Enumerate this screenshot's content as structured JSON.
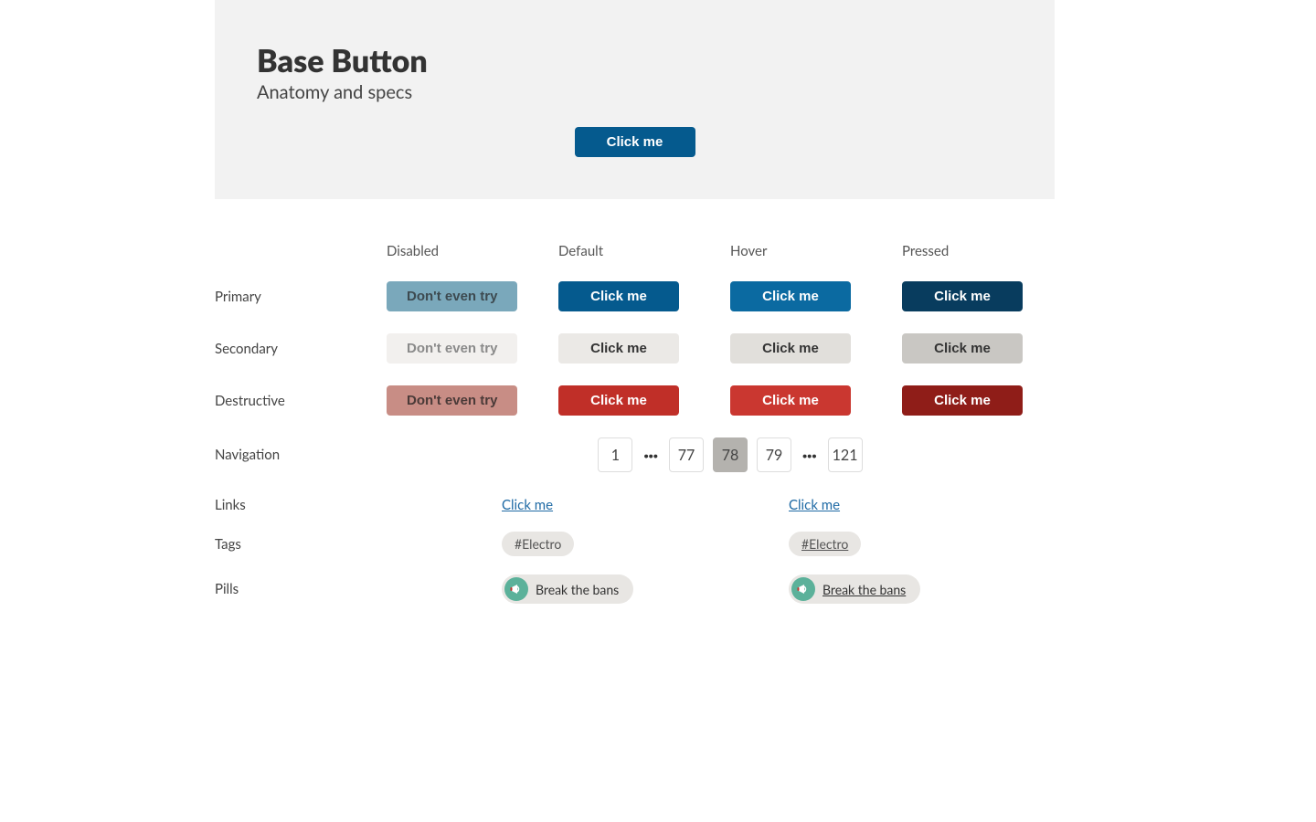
{
  "hero": {
    "title": "Base Button",
    "subtitle": "Anatomy and specs",
    "cta": "Click me"
  },
  "columns": {
    "disabled": "Disabled",
    "default": "Default",
    "hover": "Hover",
    "pressed": "Pressed"
  },
  "rows": {
    "primary": "Primary",
    "secondary": "Secondary",
    "destructive": "Destructive",
    "navigation": "Navigation",
    "links": "Links",
    "tags": "Tags",
    "pills": "Pills"
  },
  "labels": {
    "disabled": "Don't even try",
    "click": "Click me"
  },
  "pagination": {
    "first": "1",
    "prev": "77",
    "current": "78",
    "next": "79",
    "last": "121",
    "ellipsis": "···"
  },
  "link": {
    "text": "Click me"
  },
  "tag": {
    "text": "#Electro"
  },
  "pill": {
    "text": "Break the bans"
  }
}
